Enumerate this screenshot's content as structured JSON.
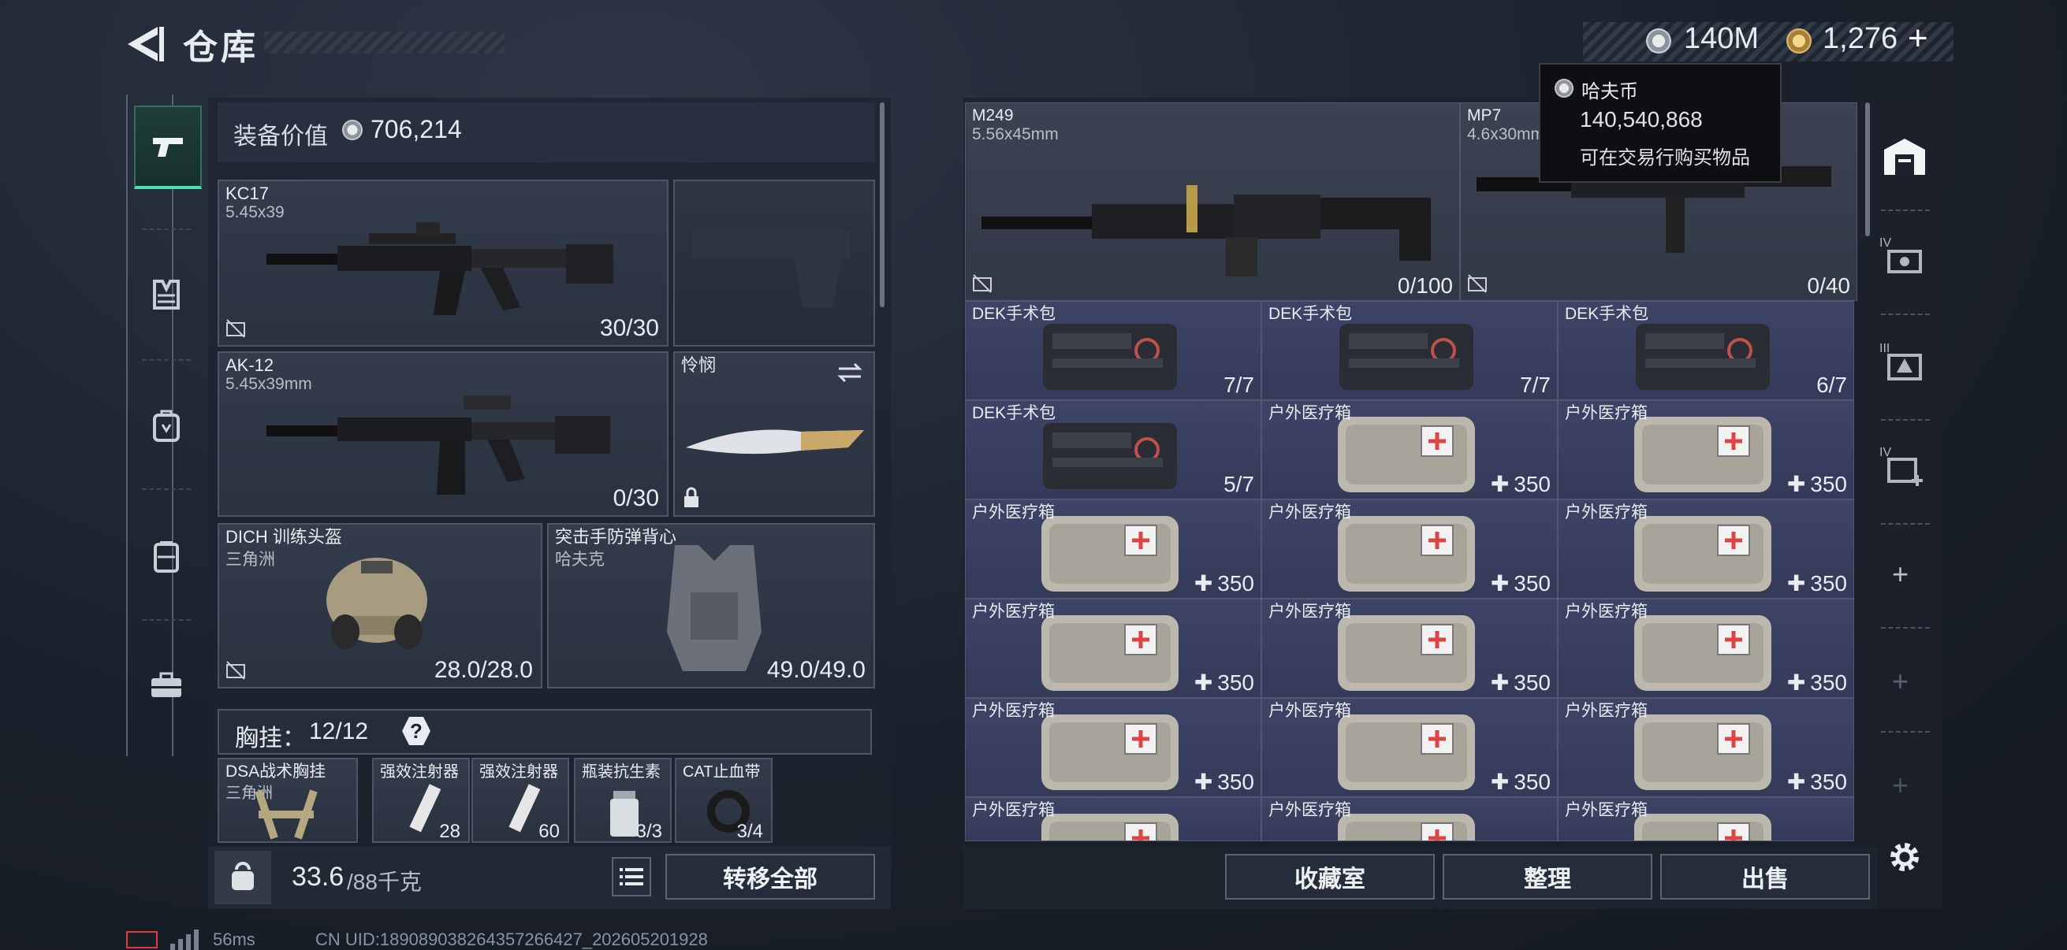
{
  "header": {
    "title": "仓库"
  },
  "currency": {
    "hafu": "140M",
    "coin": "1,276",
    "add": "+"
  },
  "tooltip": {
    "title": "哈夫币",
    "amount": "140,540,868",
    "desc": "可在交易行购买物品"
  },
  "equipment": {
    "value_label": "装备价值",
    "value": "706,214",
    "primary1": {
      "name": "KC17",
      "ammo": "5.45x39",
      "count": "30/30"
    },
    "pistol": {
      "name": "",
      "count": ""
    },
    "primary2": {
      "name": "AK-12",
      "ammo": "5.45x39mm",
      "count": "0/30"
    },
    "melee": {
      "name": "怜悯"
    },
    "helmet": {
      "name": "DICH 训练头盔",
      "sub": "三角洲",
      "durability": "28.0/28.0"
    },
    "armor": {
      "name": "突击手防弹背心",
      "sub": "哈夫克",
      "durability": "49.0/49.0"
    },
    "chest": {
      "label": "胸挂：",
      "count": "12/12",
      "help": "?"
    },
    "chest_items": [
      {
        "name": "DSA战术胸挂",
        "sub": "三角洲",
        "val": ""
      },
      {
        "name": "强效注射器",
        "val": "28"
      },
      {
        "name": "强效注射器",
        "val": "60"
      },
      {
        "name": "瓶装抗生素",
        "val": "3/3"
      },
      {
        "name": "CAT止血带",
        "val": "3/4"
      }
    ],
    "weight": "33.6",
    "weight_max": "/88千克",
    "weight_icon": "KG",
    "transfer_all": "转移全部"
  },
  "storage": {
    "m249": {
      "name": "M249",
      "ammo": "5.56x45mm",
      "count": "0/100"
    },
    "mp7": {
      "name": "MP7",
      "ammo": "4.6x30mm",
      "count": "0/40"
    },
    "rows": [
      [
        {
          "name": "DEK手术包",
          "val": "7/7",
          "kind": "kit"
        },
        {
          "name": "DEK手术包",
          "val": "7/7",
          "kind": "kit"
        },
        {
          "name": "DEK手术包",
          "val": "6/7",
          "kind": "kit"
        }
      ],
      [
        {
          "name": "DEK手术包",
          "val": "5/7",
          "kind": "kit"
        },
        {
          "name": "户外医疗箱",
          "val": "350",
          "kind": "med"
        },
        {
          "name": "户外医疗箱",
          "val": "350",
          "kind": "med"
        }
      ],
      [
        {
          "name": "户外医疗箱",
          "val": "350",
          "kind": "med"
        },
        {
          "name": "户外医疗箱",
          "val": "350",
          "kind": "med"
        },
        {
          "name": "户外医疗箱",
          "val": "350",
          "kind": "med"
        }
      ],
      [
        {
          "name": "户外医疗箱",
          "val": "350",
          "kind": "med"
        },
        {
          "name": "户外医疗箱",
          "val": "350",
          "kind": "med"
        },
        {
          "name": "户外医疗箱",
          "val": "350",
          "kind": "med"
        }
      ],
      [
        {
          "name": "户外医疗箱",
          "val": "350",
          "kind": "med"
        },
        {
          "name": "户外医疗箱",
          "val": "350",
          "kind": "med"
        },
        {
          "name": "户外医疗箱",
          "val": "350",
          "kind": "med"
        }
      ],
      [
        {
          "name": "户外医疗箱",
          "val": "",
          "kind": "med"
        },
        {
          "name": "户外医疗箱",
          "val": "",
          "kind": "med"
        },
        {
          "name": "户外医疗箱",
          "val": "",
          "kind": "med"
        }
      ]
    ],
    "buttons": {
      "collection": "收藏室",
      "sort": "整理",
      "sell": "出售"
    },
    "side_labels": {
      "t1": "IV",
      "t2": "III",
      "t3": "IV",
      "add": "+"
    }
  },
  "footer": {
    "ping": "56ms",
    "uid": "CN UID:1890890382643572664​27_202605201928"
  }
}
